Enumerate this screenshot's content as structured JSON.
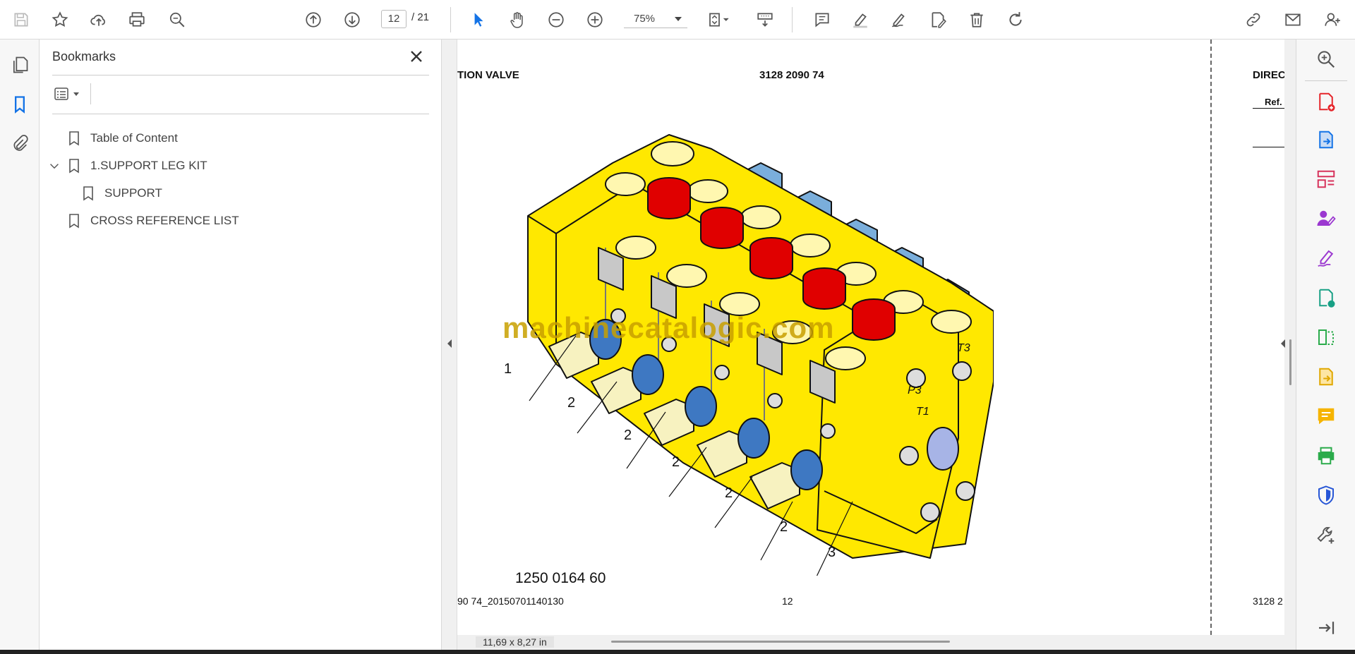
{
  "toolbar": {
    "page_current": "12",
    "page_total": "/  21",
    "zoom": "75%",
    "icons": [
      "save-icon",
      "star-icon",
      "upload-icon",
      "print-icon",
      "zoom-search-icon",
      "prev-page-icon",
      "next-page-icon",
      "select-arrow-icon",
      "hand-icon",
      "zoom-out-icon",
      "zoom-in-icon",
      "fit-page-icon",
      "scroll-mode-icon",
      "comment-icon",
      "highlight-icon",
      "sign-icon",
      "edit-icon",
      "delete-icon",
      "rotate-icon",
      "share-link-icon",
      "email-icon",
      "account-icon"
    ]
  },
  "bookmarks": {
    "title": "Bookmarks",
    "items": [
      {
        "label": "Table of Content",
        "level": 0,
        "expanded": false
      },
      {
        "label": "1.SUPPORT LEG KIT",
        "level": 0,
        "expanded": true
      },
      {
        "label": "SUPPORT",
        "level": 1,
        "expanded": false
      },
      {
        "label": "CROSS REFERENCE LIST",
        "level": 0,
        "expanded": false
      }
    ]
  },
  "document": {
    "header_left": "TION VALVE",
    "header_center": "3128 2090 74",
    "header_right": "DIREC",
    "ref_label": "Ref.",
    "watermark": "machinecatalogic.com",
    "part_number": "1250 0164 60",
    "footer_left": "90 74_20150701140130",
    "footer_center": "12",
    "footer_right": "3128 2",
    "callouts": [
      "1",
      "2",
      "2",
      "2",
      "2",
      "2",
      "3"
    ],
    "port_labels": [
      "T3",
      "P3",
      "T1"
    ]
  },
  "status": {
    "page_size": "11,69 x 8,27 in"
  },
  "colors": {
    "accent": "#1473e6",
    "valve_yellow": "#ffe800",
    "cap_red": "#e00000",
    "fitting_blue": "#7aaedb"
  }
}
